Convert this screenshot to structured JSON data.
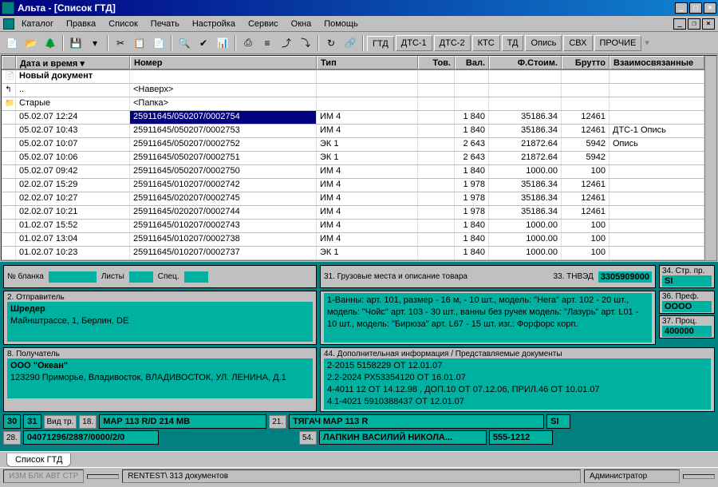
{
  "window": {
    "title": "Альта - [Список ГТД]"
  },
  "menu": [
    "Каталог",
    "Правка",
    "Список",
    "Печать",
    "Настройка",
    "Сервис",
    "Окна",
    "Помощь"
  ],
  "toolbar_tabs": [
    "ГТД",
    "ДТС-1",
    "ДТС-2",
    "КТС",
    "ТД",
    "Опись",
    "СВХ",
    "ПРОЧИЕ"
  ],
  "grid": {
    "cols": [
      "Дата и время",
      "Номер",
      "Тип",
      "Тов.",
      "Вал.",
      "Ф.Стоим.",
      "Брутто",
      "Взаимосвязанные"
    ],
    "newdoc": "Новый документ",
    "up": "..",
    "up_num": "<Наверх>",
    "folder": "Старые",
    "folder_num": "<Папка>",
    "rows": [
      {
        "dt": "05.02.07 12:24",
        "num": "25911645/050207/0002754",
        "type": "ИМ 4",
        "tov": "",
        "val": "1 840",
        "fst": "35186.34",
        "br": "12461",
        "sv": "",
        "sel": true
      },
      {
        "dt": "05.02.07 10:43",
        "num": "25911645/050207/0002753",
        "type": "ИМ 4",
        "tov": "",
        "val": "1 840",
        "fst": "35186.34",
        "br": "12461",
        "sv": "ДТС-1 Опись"
      },
      {
        "dt": "05.02.07 10:07",
        "num": "25911645/050207/0002752",
        "type": "ЭК 1",
        "tov": "",
        "val": "2 643",
        "fst": "21872.64",
        "br": "5942",
        "sv": "Опись"
      },
      {
        "dt": "05.02.07 10:06",
        "num": "25911645/050207/0002751",
        "type": "ЭК 1",
        "tov": "",
        "val": "2 643",
        "fst": "21872.64",
        "br": "5942",
        "sv": ""
      },
      {
        "dt": "05.02.07 09:42",
        "num": "25911645/050207/0002750",
        "type": "ИМ 4",
        "tov": "",
        "val": "1 840",
        "fst": "1000.00",
        "br": "100",
        "sv": ""
      },
      {
        "dt": "02.02.07 15:29",
        "num": "25911645/010207/0002742",
        "type": "ИМ 4",
        "tov": "",
        "val": "1 978",
        "fst": "35186.34",
        "br": "12461",
        "sv": ""
      },
      {
        "dt": "02.02.07 10:27",
        "num": "25911645/020207/0002745",
        "type": "ИМ 4",
        "tov": "",
        "val": "1 978",
        "fst": "35186.34",
        "br": "12461",
        "sv": ""
      },
      {
        "dt": "02.02.07 10:21",
        "num": "25911645/020207/0002744",
        "type": "ИМ 4",
        "tov": "",
        "val": "1 978",
        "fst": "35186.34",
        "br": "12461",
        "sv": ""
      },
      {
        "dt": "01.02.07 15:52",
        "num": "25911645/010207/0002743",
        "type": "ИМ 4",
        "tov": "",
        "val": "1 840",
        "fst": "1000.00",
        "br": "100",
        "sv": ""
      },
      {
        "dt": "01.02.07 13:04",
        "num": "25911645/010207/0002738",
        "type": "ИМ 4",
        "tov": "",
        "val": "1 840",
        "fst": "1000.00",
        "br": "100",
        "sv": ""
      },
      {
        "dt": "01.02.07 10:23",
        "num": "25911645/010207/0002737",
        "type": "ЭК 1",
        "tov": "",
        "val": "1 840",
        "fst": "1000.00",
        "br": "100",
        "sv": ""
      }
    ]
  },
  "form": {
    "blank_lbl": "№ бланка",
    "sheets_lbl": "Листы",
    "spec_lbl": "Спец.",
    "sender_lbl": "2. Отправитель",
    "sender_name": "Шредер",
    "sender_addr": "Майнштрассе, 1, Берлин, DE",
    "receiver_lbl": "8. Получатель",
    "receiver_name": "ООО \"Океан\"",
    "receiver_addr": "123290 Приморье, Владивосток, ВЛАДИВОСТОК, УЛ. ЛЕНИНА, Д.1",
    "goods_lbl": "31. Грузовые места и описание товара",
    "goods_text": "1-Ванны: арт. 101, размер - 16 м, -  10 шт., модель: \"Нега\" арт. 102 - 20 шт., модель: \"Чойс\" арт. 103 - 30 шт., ванны без ручек модель: \"Лазурь\" арт. L01 - 10 шт., модель: \"Бирюза\" арт. L67 - 15 шт. изг.: Форфорс корп.",
    "tnved_lbl": "33. ТНВЭД",
    "tnved": "3305909000",
    "str_lbl": "34. Стр. пр.",
    "str": "SI",
    "pref_lbl": "36. Преф.",
    "pref": "ОООО",
    "proc_lbl": "37. Проц.",
    "proc": "400000",
    "docs_lbl": "44. Дополнительная информация / Представляемые документы",
    "docs_text": "2-2015 5158229 ОТ 12.01.07\n2.2-2024 РХ53354120 ОТ 16.01.07\n4-4011 12 ОТ 14.12.98 , ДОП.10 ОТ 07.12.06, ПРИЛ.46 ОТ 10.01.07\n4.1-4021 5910388437 ОТ 12.01.07",
    "f30": "30",
    "f31": "31",
    "vid_lbl": "Вид тр.",
    "f18_lbl": "18.",
    "f18": "МАР 113 R/D 214 МВ",
    "f21_lbl": "21.",
    "f21": "ТЯГАЧ МАР 113 R",
    "f21b": "SI",
    "f28_lbl": "28.",
    "f28": "04071296/2887/0000/2/0",
    "f54_lbl": "54.",
    "f54": "ЛАПКИН ВАСИЛИЙ НИКОЛА...",
    "f54b": "555-1212"
  },
  "sheet_tab": "Список ГТД",
  "status": {
    "flags": "ИЗМ БЛК АВТ СТР",
    "info": "RENTEST\\  313 документов",
    "user": "Администратор"
  }
}
